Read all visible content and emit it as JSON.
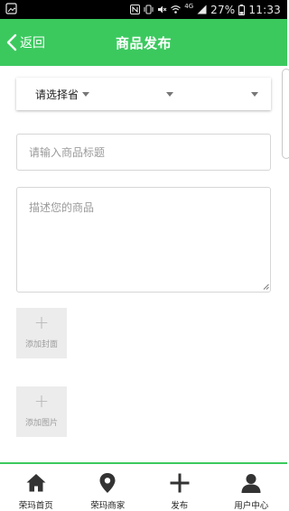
{
  "status_bar": {
    "battery_percent": "27%",
    "time": "11:33",
    "network": "4G"
  },
  "header": {
    "back_label": "返回",
    "title": "商品发布"
  },
  "form": {
    "province_select": {
      "selected": "请选择省"
    },
    "title_input": {
      "placeholder": "请输入商品标题",
      "value": ""
    },
    "description": {
      "placeholder": "描述您的商品",
      "value": ""
    },
    "cover_upload": {
      "label": "添加封面",
      "icon": "plus-icon"
    },
    "image_upload": {
      "label": "添加图片",
      "icon": "plus-icon"
    }
  },
  "tabbar": {
    "accent_color": "#3bc95e",
    "items": [
      {
        "label": "荣玛首页",
        "icon": "home-icon"
      },
      {
        "label": "荣玛商家",
        "icon": "location-pin-icon"
      },
      {
        "label": "发布",
        "icon": "plus-icon"
      },
      {
        "label": "用户中心",
        "icon": "user-icon"
      }
    ]
  },
  "colors": {
    "header_bg": "#3bc95e",
    "status_bar_bg": "#000000"
  }
}
